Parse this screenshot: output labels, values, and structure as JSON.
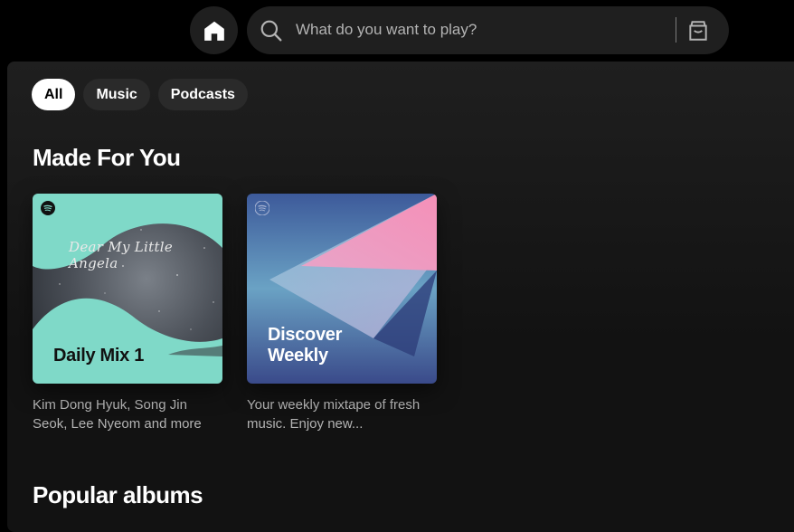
{
  "search": {
    "placeholder": "What do you want to play?"
  },
  "filters": [
    {
      "label": "All",
      "active": true
    },
    {
      "label": "Music",
      "active": false
    },
    {
      "label": "Podcasts",
      "active": false
    }
  ],
  "sections": {
    "made_for_you": {
      "title": "Made For You",
      "cards": [
        {
          "cover_title": "Daily Mix 1",
          "cover_script": "Dear My Little Angela",
          "description": "Kim Dong Hyuk, Song Jin Seok, Lee Nyeom and more"
        },
        {
          "cover_title_line1": "Discover",
          "cover_title_line2": "Weekly",
          "description": "Your weekly mixtape of fresh music. Enjoy new..."
        }
      ]
    },
    "popular_albums": {
      "title": "Popular albums"
    }
  },
  "colors": {
    "background": "#000000",
    "surface": "#1f1f1f",
    "chip": "#2a2a2a",
    "daily_mix_mint": "#7fd9c8",
    "discover_pink": "#f2a0c0",
    "discover_blue": "#4a5f9a"
  },
  "icons": {
    "home": "home-icon",
    "search": "search-icon",
    "browse": "browse-icon",
    "spotify": "spotify-logo-icon"
  }
}
